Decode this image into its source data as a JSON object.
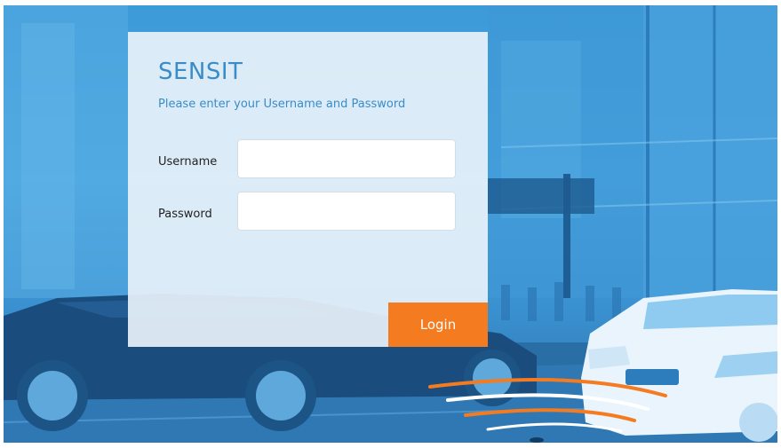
{
  "app": {
    "brand": "SENSIT"
  },
  "login": {
    "subtitle": "Please enter your Username and Password",
    "username_label": "Username",
    "username_value": "",
    "password_label": "Password",
    "password_value": "",
    "login_button": "Login"
  },
  "colors": {
    "accent": "#3a8cc8",
    "button": "#f47b20",
    "background": "#3d9ad8"
  }
}
